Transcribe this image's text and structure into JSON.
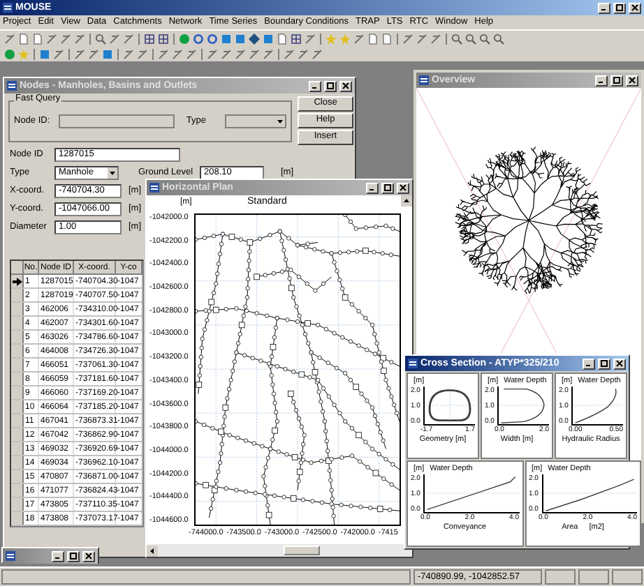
{
  "app": {
    "title": "MOUSE"
  },
  "menu": [
    "Project",
    "Edit",
    "View",
    "Data",
    "Catchments",
    "Network",
    "Time Series",
    "Boundary Conditions",
    "TRAP",
    "LTS",
    "RTC",
    "Window",
    "Help"
  ],
  "nodes_window": {
    "title": "Nodes - Manholes, Basins and Outlets",
    "active": false,
    "fast_query": {
      "label": "Fast Query",
      "node_id_label": "Node ID:",
      "type_label": "Type"
    },
    "buttons": [
      "Close",
      "Help",
      "Insert"
    ],
    "node_id": {
      "label": "Node ID",
      "value": "1287015"
    },
    "type": {
      "label": "Type",
      "value": "Manhole"
    },
    "ground_level": {
      "label": "Ground Level",
      "value": "208.10",
      "unit": "[m]"
    },
    "coords": [
      {
        "label": "X-coord.",
        "value": "-740704.30",
        "unit": "[m]"
      },
      {
        "label": "Y-coord.",
        "value": "-1047066.00",
        "unit": "[m]"
      },
      {
        "label": "Diameter",
        "value": "1.00",
        "unit": "[m]"
      }
    ],
    "table": {
      "columns": [
        "No.",
        "Node ID",
        "X-coord.",
        "Y-co"
      ],
      "rows": [
        {
          "cells": [
            "1",
            "1287015",
            "-740704.30",
            "-1047"
          ],
          "selected": true
        },
        {
          "cells": [
            "2",
            "1287019",
            "-740707.50",
            "-1047"
          ],
          "selected": false
        },
        {
          "cells": [
            "3",
            "462006",
            "-734310.00",
            "-1047"
          ],
          "selected": false
        },
        {
          "cells": [
            "4",
            "462007",
            "-734301.60",
            "-1047"
          ],
          "selected": false
        },
        {
          "cells": [
            "5",
            "463026",
            "-734786.60",
            "-1047"
          ],
          "selected": false
        },
        {
          "cells": [
            "6",
            "464008",
            "-734726.30",
            "-1047"
          ],
          "selected": false
        },
        {
          "cells": [
            "7",
            "466051",
            "-737061.30",
            "-1047"
          ],
          "selected": false
        },
        {
          "cells": [
            "8",
            "466059",
            "-737181.60",
            "-1047"
          ],
          "selected": false
        },
        {
          "cells": [
            "9",
            "466060",
            "-737169.20",
            "-1047"
          ],
          "selected": false
        },
        {
          "cells": [
            "10",
            "466064",
            "-737185.20",
            "-1047"
          ],
          "selected": false
        },
        {
          "cells": [
            "11",
            "467041",
            "-736873.31",
            "-1047"
          ],
          "selected": false
        },
        {
          "cells": [
            "12",
            "467042",
            "-736862.90",
            "-1047"
          ],
          "selected": false
        },
        {
          "cells": [
            "13",
            "469032",
            "-736920.69",
            "-1047"
          ],
          "selected": false
        },
        {
          "cells": [
            "14",
            "469034",
            "-736962.10",
            "-1047"
          ],
          "selected": false
        },
        {
          "cells": [
            "15",
            "470807",
            "-736871.00",
            "-1047"
          ],
          "selected": false
        },
        {
          "cells": [
            "16",
            "471077",
            "-736824.43",
            "-1047"
          ],
          "selected": false
        },
        {
          "cells": [
            "17",
            "473805",
            "-737110.35",
            "-1047"
          ],
          "selected": false
        },
        {
          "cells": [
            "18",
            "473808",
            "-737073.17",
            "-1047"
          ],
          "selected": false
        }
      ]
    }
  },
  "plan_window": {
    "title": "Horizontal Plan",
    "active": false,
    "unit": "[m]",
    "caption": "Standard",
    "yticks": [
      "-1042000.0",
      "-1042200.0",
      "-1042400.0",
      "-1042600.0",
      "-1042800.0",
      "-1043000.0",
      "-1043200.0",
      "-1043400.0",
      "-1043600.0",
      "-1043800.0",
      "-1044000.0",
      "-1044200.0",
      "-1044400.0",
      "-1044600.0"
    ],
    "xticks": [
      "-744000.0",
      "-743500.0",
      "-743000.0",
      "-742500.0",
      "-742000.0",
      "-7415"
    ]
  },
  "overview_window": {
    "title": "Overview",
    "active": false
  },
  "cross_section_window": {
    "title": "Cross Section - ATYP*325/210",
    "active": true,
    "panels": [
      {
        "kind": "geometry",
        "unit": "[m]",
        "yticks": [
          "2.0",
          "1.0",
          "0.0"
        ],
        "xticks": [
          "-1.7",
          "1.7"
        ],
        "xlabel": "Geometry [m]"
      },
      {
        "kind": "width",
        "unit": "[m]",
        "heading": "Water Depth",
        "yticks": [
          "2.0",
          "1.0",
          "0.0"
        ],
        "xticks": [
          "0.0",
          "2.0"
        ],
        "xlabel": "Width [m]"
      },
      {
        "kind": "radius",
        "unit": "[m]",
        "heading": "Water Depth",
        "yticks": [
          "2.0",
          "1.0",
          "0.0"
        ],
        "xticks": [
          "0.00",
          "0.50"
        ],
        "xlabel": "Hydraulic Radius"
      },
      {
        "kind": "conveyance",
        "unit": "[m]",
        "heading": "Water Depth",
        "yticks": [
          "2.0",
          "1.0",
          "0.0"
        ],
        "xticks": [
          "0.0",
          "2.0",
          "4.0"
        ],
        "xlabel": "Conveyance"
      },
      {
        "kind": "area",
        "unit": "[m]",
        "heading": "Water Depth",
        "yticks": [
          "2.0",
          "1.0",
          "0.0"
        ],
        "xticks": [
          "0.0",
          "2.0",
          "4.0"
        ],
        "xlabel": "Area",
        "xunit": "[m2]"
      }
    ]
  },
  "status_bar": {
    "coords": "-740890.99, -1042852.57"
  }
}
